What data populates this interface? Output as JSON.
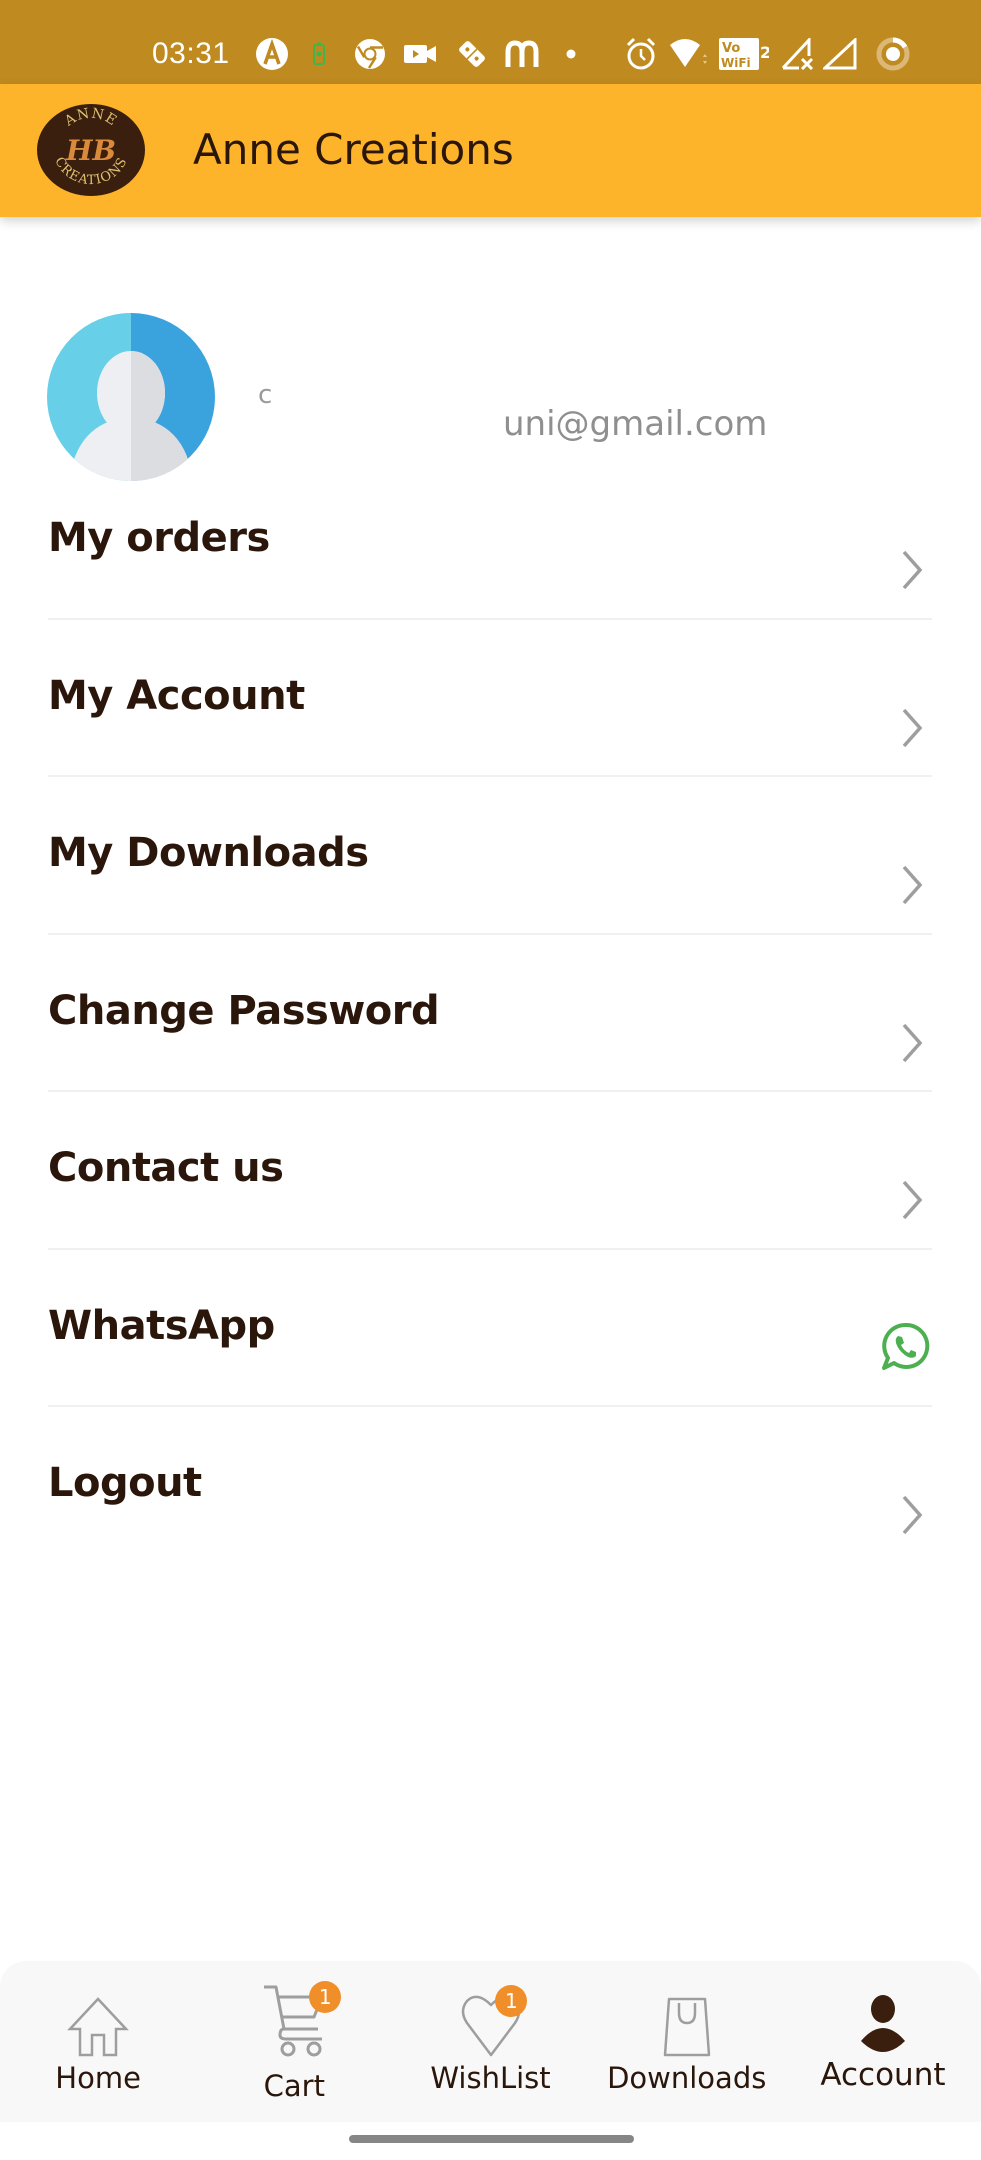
{
  "status_bar": {
    "time": "03:31",
    "icons": [
      "arc-app-icon",
      "battery-saver-icon",
      "chrome-icon",
      "video-camera-icon",
      "domino-icon",
      "m-app-icon",
      "notification-dot-icon",
      "alarm-icon",
      "wifi-icon",
      "vowifi-2-icon",
      "signal-no-service-icon",
      "signal-icon",
      "battery-ring-icon"
    ],
    "vowifi_text_top": "Vo",
    "vowifi_text_bottom": "WiFi",
    "vowifi_sim": "2"
  },
  "app_bar": {
    "title": "Anne Creations",
    "logo_text_top": "ANNE",
    "logo_monogram": "HB",
    "logo_text_bottom": "CREATIONS"
  },
  "profile": {
    "name": "c",
    "email": "uni@gmail.com"
  },
  "menu": [
    {
      "label": "My orders",
      "icon": "chevron-right-icon"
    },
    {
      "label": "My Account",
      "icon": "chevron-right-icon"
    },
    {
      "label": "My Downloads",
      "icon": "chevron-right-icon"
    },
    {
      "label": "Change Password",
      "icon": "chevron-right-icon"
    },
    {
      "label": "Contact us",
      "icon": "chevron-right-icon"
    },
    {
      "label": "WhatsApp",
      "icon": "whatsapp-icon"
    },
    {
      "label": "Logout",
      "icon": "chevron-right-icon"
    }
  ],
  "bottom_nav": [
    {
      "label": "Home",
      "icon": "home-icon",
      "active": false
    },
    {
      "label": "Cart",
      "icon": "cart-icon",
      "badge": "1",
      "active": false
    },
    {
      "label": "WishList",
      "icon": "heart-icon",
      "badge": "1",
      "active": false
    },
    {
      "label": "Downloads",
      "icon": "shopping-bag-icon",
      "active": false
    },
    {
      "label": "Account",
      "icon": "person-icon",
      "active": true
    }
  ],
  "colors": {
    "status_bar": "#bf8a20",
    "app_bar": "#fdb42a",
    "text_dark": "#2a160a",
    "badge": "#f08f2a",
    "whatsapp_green": "#4caf50",
    "icon_gray": "#9e9e9e"
  }
}
